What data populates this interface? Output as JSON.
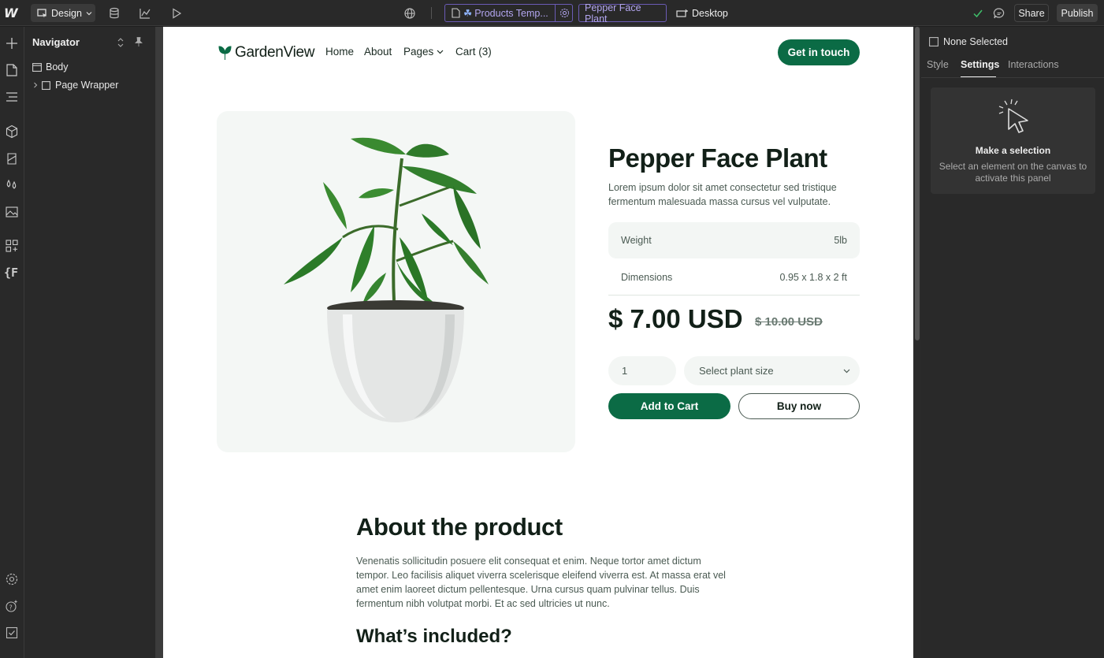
{
  "topbar": {
    "mode_label": "Design",
    "page_label": "Products Temp...",
    "item_label": "Pepper Face Plant",
    "breakpoint_label": "Desktop",
    "share_label": "Share",
    "publish_label": "Publish"
  },
  "navigator": {
    "title": "Navigator",
    "items": [
      {
        "label": "Body"
      },
      {
        "label": "Page Wrapper"
      }
    ]
  },
  "site": {
    "brand": "GardenView",
    "nav": [
      "Home",
      "About",
      "Pages",
      "Cart (3)"
    ],
    "cta": "Get in touch",
    "product": {
      "title": "Pepper Face Plant",
      "description": "Lorem ipsum dolor sit amet consectetur sed tristique fermentum malesuada massa cursus vel vulputate.",
      "specs": [
        {
          "label": "Weight",
          "value": "5lb"
        },
        {
          "label": "Dimensions",
          "value": "0.95 x 1.8 x 2 ft"
        }
      ],
      "price": "$ 7.00 USD",
      "old_price": "$ 10.00 USD",
      "quantity": "1",
      "size_placeholder": "Select plant size",
      "add_to_cart": "Add to Cart",
      "buy_now": "Buy now"
    },
    "about": {
      "title": "About the product",
      "text": "Venenatis sollicitudin posuere elit consequat et enim. Neque tortor amet dictum tempor. Leo facilisis aliquet viverra scelerisque eleifend viverra est. At massa erat vel amet enim laoreet dictum pellentesque. Urna cursus quam pulvinar tellus. Duis fermentum nibh volutpat morbi. Et ac sed ultricies ut nunc.",
      "included_title": "What’s included?"
    }
  },
  "right_panel": {
    "selection_label": "None Selected",
    "tabs": [
      "Style",
      "Settings",
      "Interactions"
    ],
    "active_tab": "Settings",
    "empty_title": "Make a selection",
    "empty_text": "Select an element on the canvas to activate this panel"
  },
  "colors": {
    "brand_green": "#0b6b45",
    "accent_purple": "#b3a6f0",
    "check_green": "#3fbf6a"
  }
}
